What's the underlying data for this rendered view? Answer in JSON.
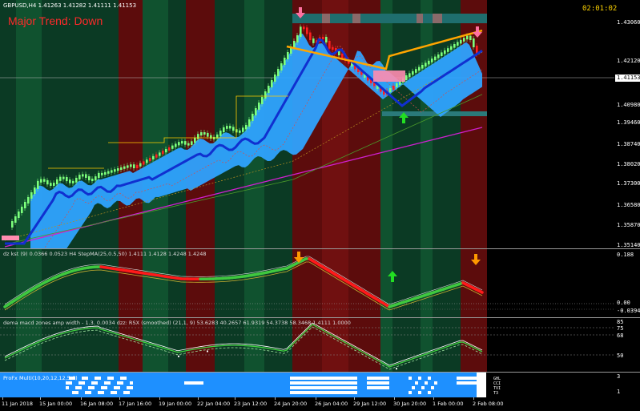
{
  "symbol_line": "GBPUSD,H4  1.41263 1.41282 1.41111 1.41153",
  "major_trend": "Major Trend: Down",
  "clock": "02:01:02",
  "current_price": "1.41153",
  "price_axis": [
    "1.43060",
    "1.42120",
    "1.40980",
    "1.39460",
    "1.38740",
    "1.38020",
    "1.37300",
    "1.36580",
    "1.35870",
    "1.35140"
  ],
  "indicator1": {
    "label": "dz kst (9) 0.0366 0.0523  H4 StepMA(25,0.5,50) 1.4111 1.4128 1.4248 1.4248",
    "axis": [
      "0.188",
      "0.00",
      "-0.0394"
    ]
  },
  "indicator2": {
    "label": "dema macd zones amp width - 1.3. 0.0034  dzz: RSX (smoothed) (21,1, 9) 53.6283 40.2657 61.9319 54.3738 58.3468 1.4111 1.0000",
    "axis": [
      "85",
      "75",
      "68",
      "50"
    ]
  },
  "indicator3": {
    "label": "ProFx Multi(10,20,12,12,5,6)",
    "axis": [
      "3",
      "1"
    ],
    "rows": [
      "GHL",
      "CCI",
      "TVI",
      "T3"
    ]
  },
  "time_axis": [
    "11 Jan 2018",
    "15 Jan 00:00",
    "16 Jan 08:00",
    "17 Jan 16:00",
    "19 Jan 00:00",
    "22 Jan 04:00",
    "23 Jan 12:00",
    "24 Jan 20:00",
    "26 Jan 04:00",
    "29 Jan 12:00",
    "30 Jan 20:00",
    "1 Feb 00:00",
    "2 Feb 08:00"
  ],
  "colors": {
    "up_candle": "#7cff7c",
    "down_candle": "#ff2020",
    "zone_green": "#0a3d26",
    "zone_red": "#5a0a0a",
    "zone_green_bright": "#0f5a36",
    "cloud": "#2fa3ff",
    "ma_blue": "#1030d0",
    "ma_orange": "#ffa500",
    "ma_magenta": "#d020d0",
    "kst_green": "#3fc83f",
    "kst_red": "#ff1a1a",
    "arrow_up": "#22dd22",
    "arrow_down": "#ff9900",
    "pink_arrow": "#ff70a0"
  }
}
